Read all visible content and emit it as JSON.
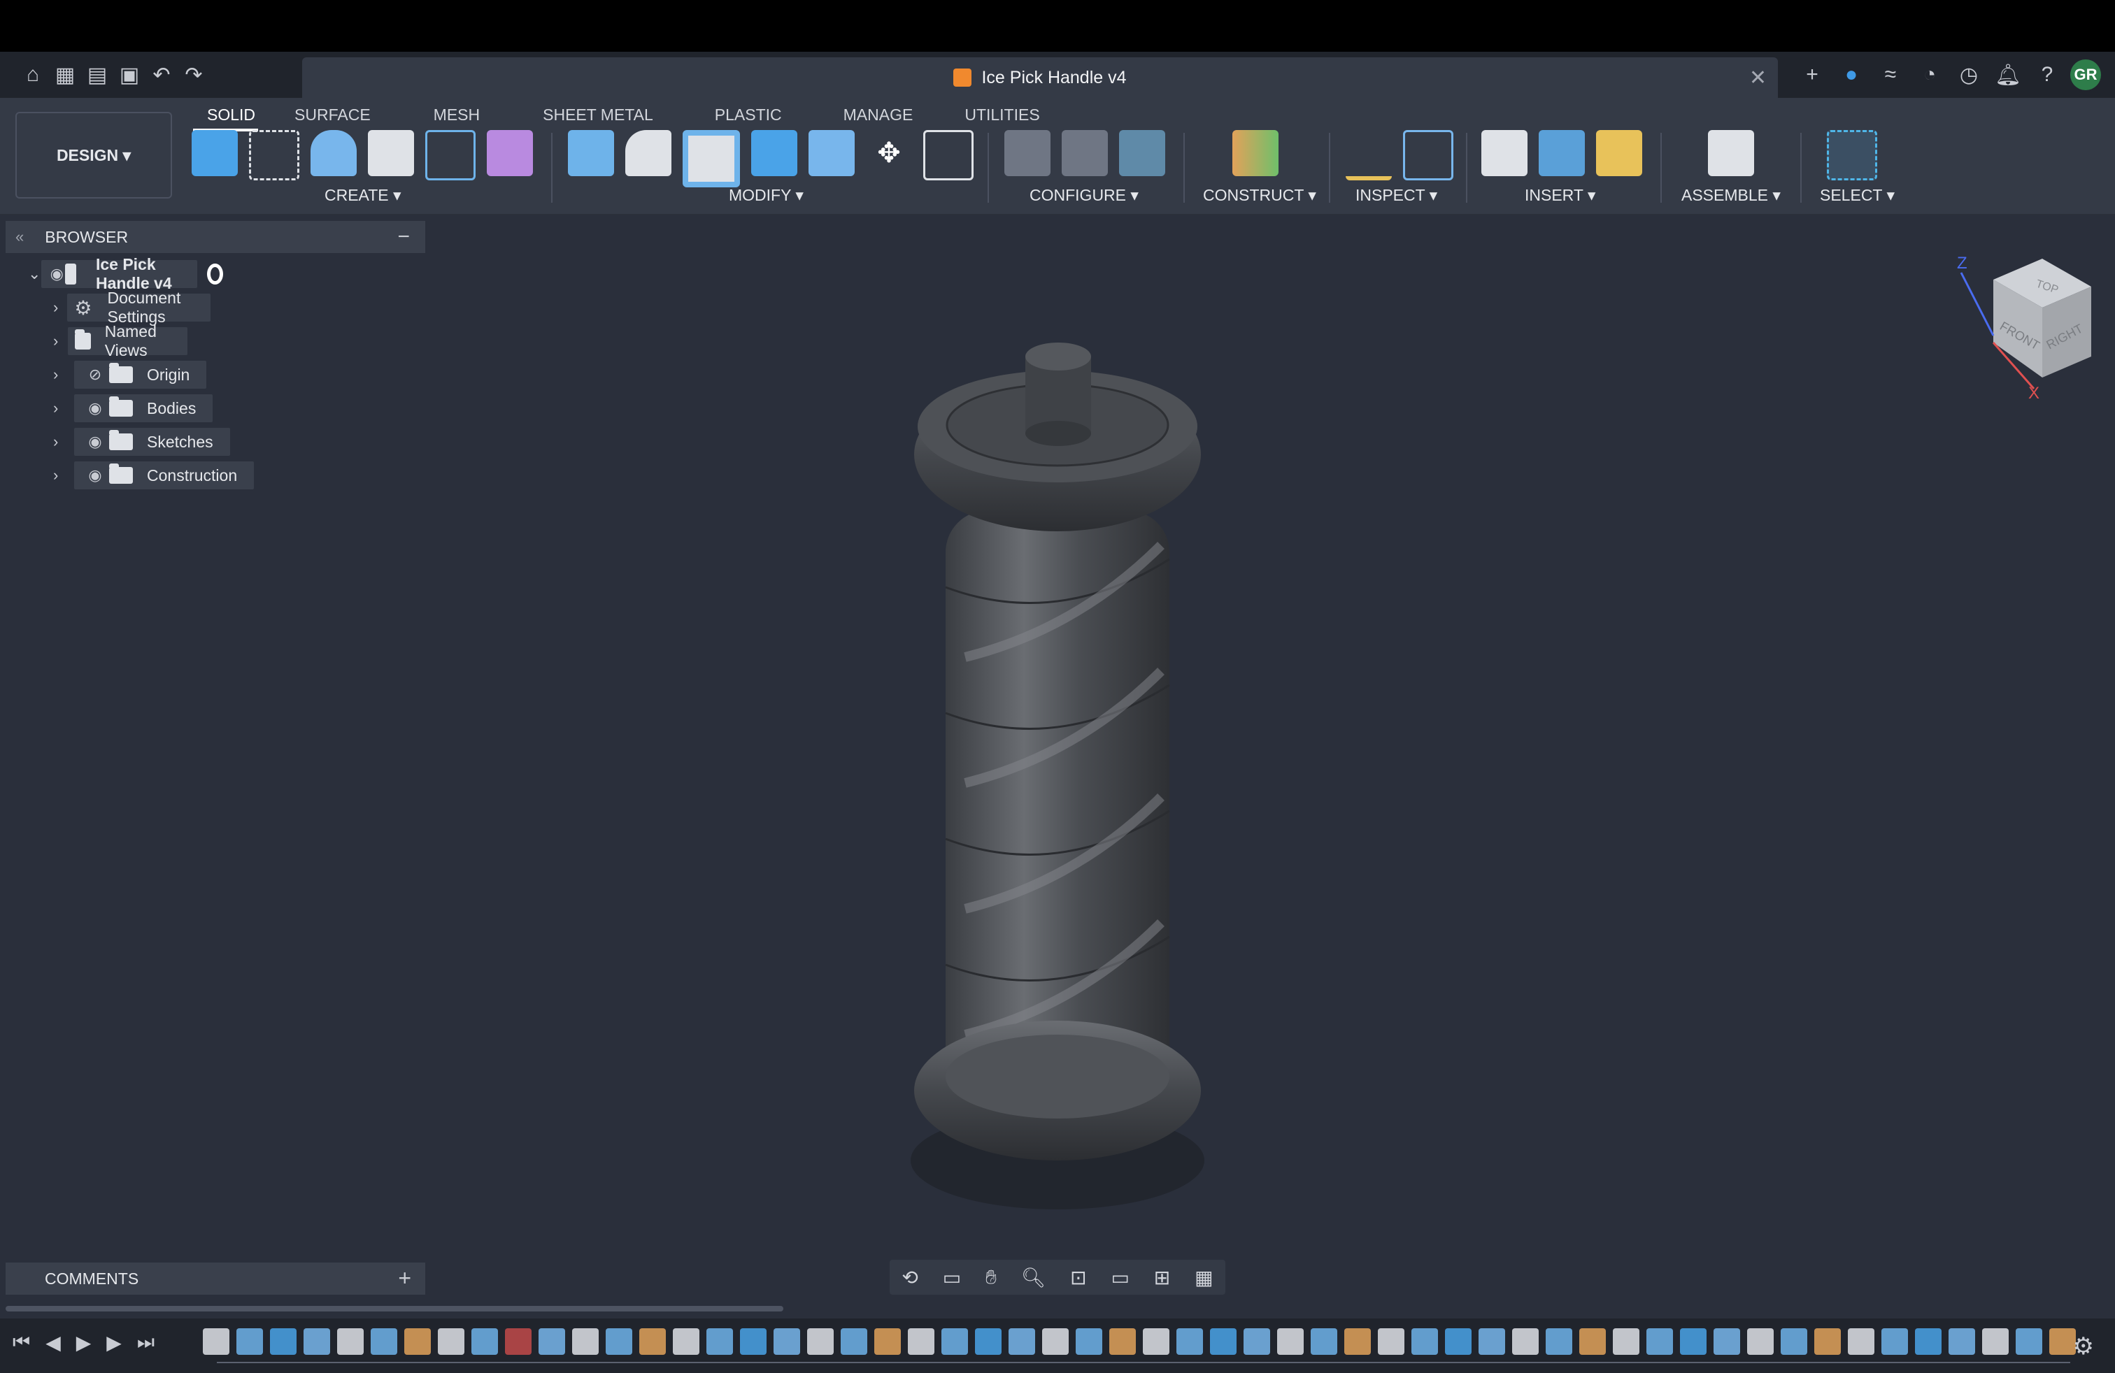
{
  "document": {
    "title": "Ice Pick Handle v4"
  },
  "user": {
    "initials": "GR"
  },
  "workspace": {
    "label": "DESIGN"
  },
  "tabs": [
    "SOLID",
    "SURFACE",
    "MESH",
    "SHEET METAL",
    "PLASTIC",
    "MANAGE",
    "UTILITIES"
  ],
  "groups": {
    "create": "CREATE",
    "modify": "MODIFY",
    "configure": "CONFIGURE",
    "construct": "CONSTRUCT",
    "inspect": "INSPECT",
    "insert": "INSERT",
    "assemble": "ASSEMBLE",
    "select": "SELECT"
  },
  "browser": {
    "title": "BROWSER",
    "root": "Ice Pick Handle v4",
    "items": [
      "Document Settings",
      "Named Views",
      "Origin",
      "Bodies",
      "Sketches",
      "Construction"
    ]
  },
  "viewcube": {
    "top": "TOP",
    "front": "FRONT",
    "right": "RIGHT",
    "z": "Z",
    "x": "X"
  },
  "comments": {
    "title": "COMMENTS"
  },
  "colors": {
    "accent": "#3f9ae6",
    "doc_icon": "#f0892e",
    "background": "#2a2f3b"
  }
}
